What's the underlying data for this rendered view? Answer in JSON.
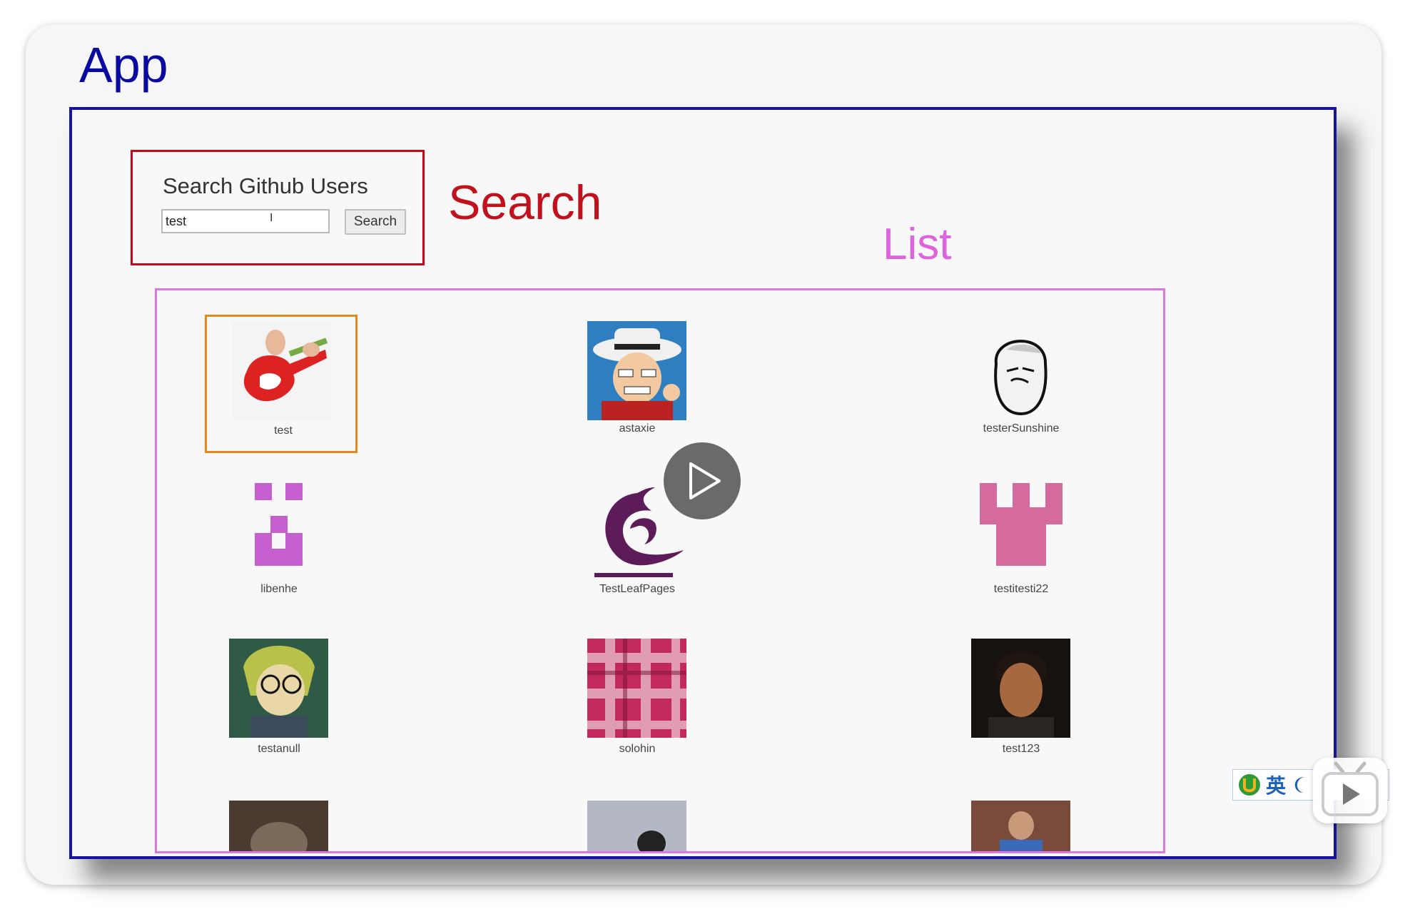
{
  "labels": {
    "app": "App",
    "search": "Search",
    "list": "List"
  },
  "search": {
    "title": "Search Github Users",
    "input_value": "test",
    "button_label": "Search"
  },
  "users": [
    {
      "login": "test",
      "avatar": "guitar-avatar"
    },
    {
      "login": "astaxie",
      "avatar": "cowboy-cartoon-avatar"
    },
    {
      "login": "testerSunshine",
      "avatar": "meme-face-avatar"
    },
    {
      "login": "libenhe",
      "avatar": "identicon-avatar"
    },
    {
      "login": "TestLeafPages",
      "avatar": "swirl-logo-avatar"
    },
    {
      "login": "testitesti22",
      "avatar": "identicon-avatar"
    },
    {
      "login": "testanull",
      "avatar": "anime-character-avatar"
    },
    {
      "login": "solohin",
      "avatar": "plaid-fabric-avatar"
    },
    {
      "login": "test123",
      "avatar": "portrait-photo-avatar"
    },
    {
      "login": "",
      "avatar": "cat-photo-avatar"
    },
    {
      "login": "",
      "avatar": "photo-avatar"
    },
    {
      "login": "",
      "avatar": "photo-avatar"
    }
  ],
  "ime": {
    "language": "英"
  },
  "colors": {
    "app_border": "#15139f",
    "search_border": "#c0091b",
    "list_border": "#dc79dc",
    "selected_border": "#e38a1e"
  }
}
